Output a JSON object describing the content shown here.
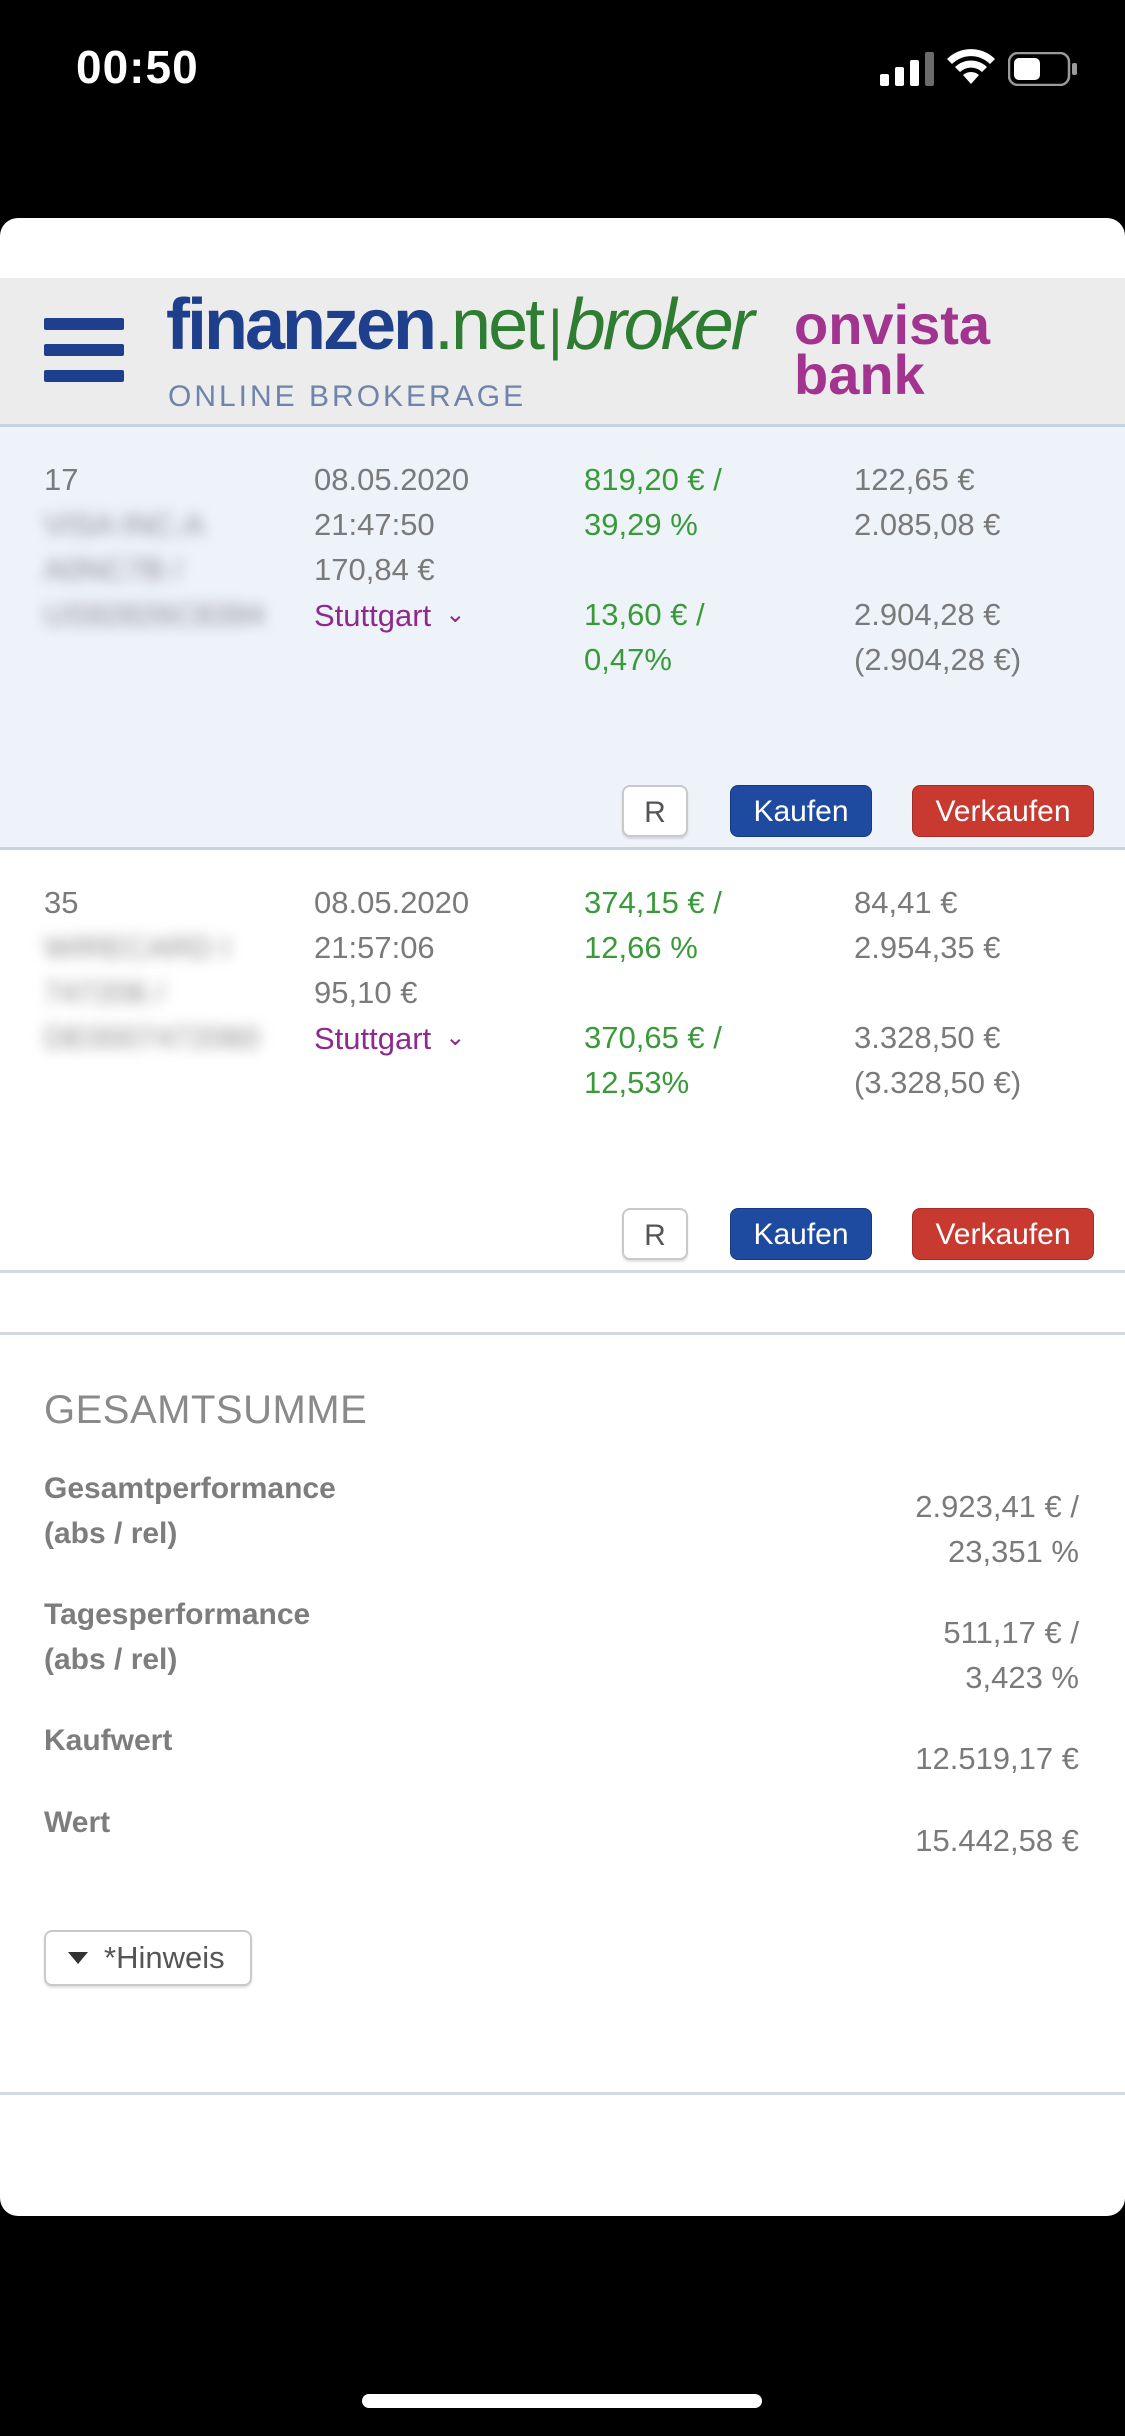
{
  "status_bar": {
    "time": "00:50",
    "signal_icon": "cellular-signal-icon",
    "wifi_icon": "wifi-icon",
    "battery_icon": "battery-icon",
    "battery_level": 0.5
  },
  "header": {
    "menu_icon": "hamburger-menu-icon",
    "logo_left": {
      "brand": "finanzen",
      "net": ".net",
      "separator": "|",
      "product": "broker",
      "tagline": "ONLINE BROKERAGE"
    },
    "logo_right": {
      "line1": "onvista",
      "line2": "bank"
    }
  },
  "positions": [
    {
      "quantity": "17",
      "name_blurred": [
        "VISA INC.A",
        "A0NC7B /",
        "US92826C8394"
      ],
      "date": "08.05.2020",
      "time": "21:47:50",
      "price": "170,84 €",
      "exchange": "Stuttgart",
      "total_perf_abs": "819,20 € /",
      "total_perf_rel": "39,29 %",
      "day_perf_abs": "13,60 € /",
      "day_perf_rel": "0,47%",
      "buy_price": "122,65 €",
      "buy_value": "2.085,08 €",
      "current_value": "2.904,28 €",
      "current_value_paren": "(2.904,28 €)",
      "btn_r": "R",
      "btn_buy": "Kaufen",
      "btn_sell": "Verkaufen"
    },
    {
      "quantity": "35",
      "name_blurred": [
        "WIRECARD I",
        "747206 /",
        "DE0007472060"
      ],
      "date": "08.05.2020",
      "time": "21:57:06",
      "price": "95,10 €",
      "exchange": "Stuttgart",
      "total_perf_abs": "374,15 € /",
      "total_perf_rel": "12,66 %",
      "day_perf_abs": "370,65 € /",
      "day_perf_rel": "12,53%",
      "buy_price": "84,41 €",
      "buy_value": "2.954,35 €",
      "current_value": "3.328,50 €",
      "current_value_paren": "(3.328,50 €)",
      "btn_r": "R",
      "btn_buy": "Kaufen",
      "btn_sell": "Verkaufen"
    }
  ],
  "summary": {
    "title": "GESAMTSUMME",
    "total_perf_label_1": "Gesamtperformance",
    "total_perf_label_2": "(abs / rel)",
    "total_perf_abs": "2.923,41 € /",
    "total_perf_rel": "23,351 %",
    "day_perf_label_1": "Tagesperformance",
    "day_perf_label_2": "(abs / rel)",
    "day_perf_abs": "511,17 € /",
    "day_perf_rel": "3,423 %",
    "buy_value_label": "Kaufwert",
    "buy_value": "12.519,17 €",
    "value_label": "Wert",
    "value": "15.442,58 €",
    "hint_button": "*Hinweis",
    "hint_icon": "triangle-down-icon"
  },
  "colors": {
    "brand_blue": "#1e3f8c",
    "positive_green": "#3a9a3a",
    "exchange_purple": "#8e2a8c",
    "buy_button": "#1e4aa0",
    "sell_button": "#c8392f",
    "onvista_purple": "#a2338f"
  }
}
